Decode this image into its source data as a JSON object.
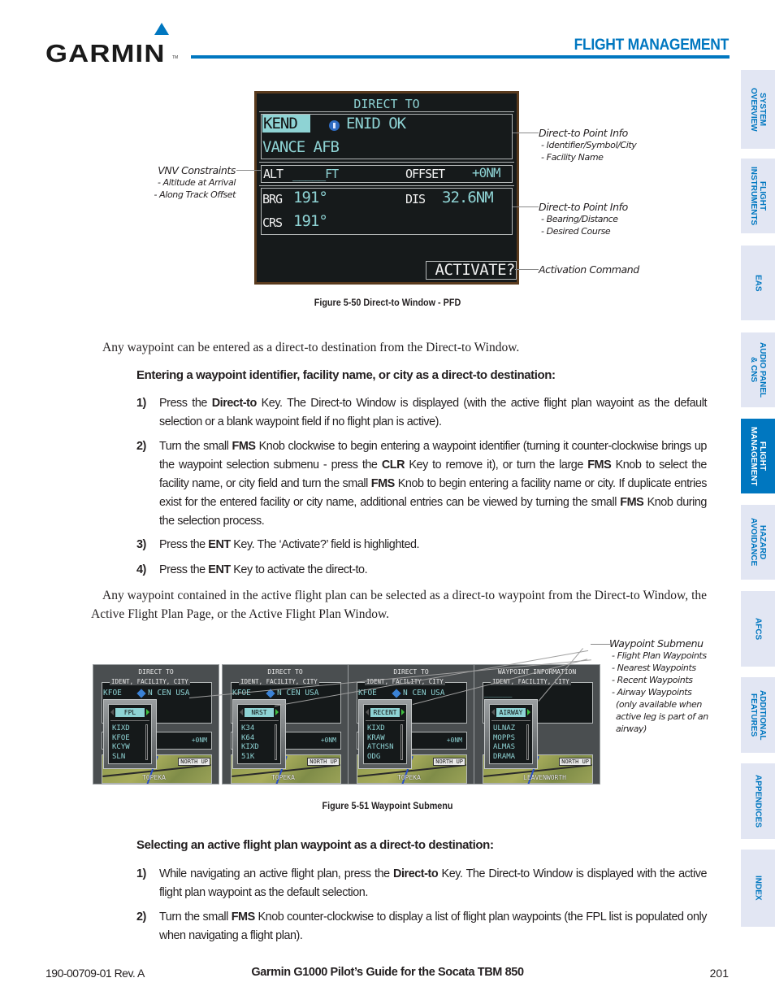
{
  "header": {
    "logo_text": "GARMIN",
    "logo_tm": "TM",
    "section_title": "FLIGHT MANAGEMENT",
    "brand_color": "#0077c0"
  },
  "side_tabs": [
    {
      "label": "SYSTEM\nOVERVIEW",
      "active": false
    },
    {
      "label": "FLIGHT\nINSTRUMENTS",
      "active": false
    },
    {
      "label": "EAS",
      "active": false
    },
    {
      "label": "AUDIO PANEL\n& CNS",
      "active": false
    },
    {
      "label": "FLIGHT\nMANAGEMENT",
      "active": true
    },
    {
      "label": "HAZARD\nAVOIDANCE",
      "active": false
    },
    {
      "label": "AFCS",
      "active": false
    },
    {
      "label": "ADDITIONAL\nFEATURES",
      "active": false
    },
    {
      "label": "APPENDICES",
      "active": false
    },
    {
      "label": "INDEX",
      "active": false
    }
  ],
  "figure_550": {
    "window_title": "DIRECT TO",
    "ident": "KEND",
    "city": "ENID OK",
    "facility": "VANCE AFB",
    "alt_label": "ALT",
    "alt_value": "_____FT",
    "offset_label": "OFFSET",
    "offset_value": "+0NM",
    "brg_label": "BRG",
    "brg_value": "191°",
    "dis_label": "DIS",
    "dis_value": "32.6NM",
    "crs_label": "CRS",
    "crs_value": "191°",
    "activate_label": "ACTIVATE?",
    "callouts": {
      "vnv_title": "VNV Constraints",
      "vnv_items": [
        "- Altitude at Arrival",
        "- Along Track Offset"
      ],
      "point_info_1_title": "Direct-to Point Info",
      "point_info_1_items": [
        "- Identifier/Symbol/City",
        "- Facility Name"
      ],
      "point_info_2_title": "Direct-to Point Info",
      "point_info_2_items": [
        "- Bearing/Distance",
        "- Desired Course"
      ],
      "activation": "Activation Command"
    },
    "caption": "Figure 5-50  Direct-to Window - PFD"
  },
  "intro_paragraph": "Any waypoint can be entered as a direct-to destination from the Direct-to Window.",
  "section1": {
    "heading": "Entering a waypoint identifier, facility name, or city as a direct-to destination:",
    "steps": [
      {
        "num": "1)",
        "html": "Press the <b>Direct-to</b> Key.  The Direct-to Window is displayed (with the active flight plan wayoint as the default selection or a blank waypoint field if no flight plan is active)."
      },
      {
        "num": "2)",
        "html": "Turn the small <b>FMS</b> Knob clockwise to begin entering a waypoint identifier (turning it counter-clockwise brings up the waypoint selection submenu - press the <b>CLR</b> Key to remove it), or turn the large <b>FMS</b> Knob to select the facility name, or city field and turn the small <b>FMS</b> Knob to begin entering a facility name or city.  If duplicate entries exist for the entered facility or city name, additional entries can be viewed by turning the small <b>FMS</b> Knob during the selection process."
      },
      {
        "num": "3)",
        "html": "Press the <b>ENT</b> Key.  The ‘Activate?’ field is highlighted."
      },
      {
        "num": "4)",
        "html": "Press the <b>ENT</b> Key to activate the direct-to."
      }
    ]
  },
  "middle_paragraph": "Any waypoint contained in the active flight plan can be selected as a direct-to waypoint from the Direct-to Window, the Active Flight Plan Page, or the Active Flight Plan Window.",
  "figure_551": {
    "screens": [
      {
        "title": "DIRECT TO",
        "field_label": "IDENT, FACILITY, CITY",
        "ident": "KFOE",
        "city": "N CEN USA",
        "offset": "+0NM",
        "category": "FPL",
        "items": [
          "KIXD",
          "KFOE",
          "KCYW",
          "SLN"
        ],
        "map_label": "NORTH UP",
        "town": "TOPEKA"
      },
      {
        "title": "DIRECT TO",
        "field_label": "IDENT, FACILITY, CITY",
        "ident": "KFOE",
        "city": "N CEN USA",
        "offset": "+0NM",
        "category": "NRST",
        "items": [
          "K34",
          "K64",
          "KIXD",
          "51K"
        ],
        "map_label": "NORTH UP",
        "town": "TOPEKA"
      },
      {
        "title": "DIRECT TO",
        "field_label": "IDENT, FACILITY, CITY",
        "ident": "KFOE",
        "city": "N CEN USA",
        "offset": "+0NM",
        "category": "RECENT",
        "items": [
          "KIXD",
          "KRAW",
          "ATCHSN",
          "ODG"
        ],
        "map_label": "NORTH UP",
        "town": "TOPEKA"
      },
      {
        "title": "WAYPOINT INFORMATION",
        "field_label": "IDENT, FACILITY, CITY",
        "ident": "______",
        "city": "",
        "offset": "",
        "category": "AIRWAY",
        "items": [
          "ULNAZ",
          "MOPPS",
          "ALMAS",
          "DRAMA"
        ],
        "map_label": "NORTH UP",
        "town": "LEAVENWORTH"
      }
    ],
    "callout_title": "Waypoint Submenu",
    "callout_items": [
      "- Flight Plan Waypoints",
      "- Nearest Waypoints",
      "- Recent Waypoints",
      "- Airway Waypoints",
      "  (only available when",
      "  active leg is part of an",
      "  airway)"
    ],
    "caption": "Figure 5-51  Waypoint Submenu"
  },
  "section2": {
    "heading": "Selecting an active flight plan waypoint as a direct-to destination:",
    "steps": [
      {
        "num": "1)",
        "html": "While navigating an active flight plan, press the <b>Direct-to</b> Key.  The Direct-to Window is displayed with the active flight plan waypoint as the default selection."
      },
      {
        "num": "2)",
        "html": "Turn the small <b>FMS</b> Knob counter-clockwise to display a list of flight plan waypoints (the FPL list is populated only when navigating a flight plan)."
      }
    ]
  },
  "footer": {
    "doc_number": "190-00709-01  Rev. A",
    "title": "Garmin G1000 Pilot’s Guide for the Socata TBM 850",
    "page_number": "201"
  }
}
